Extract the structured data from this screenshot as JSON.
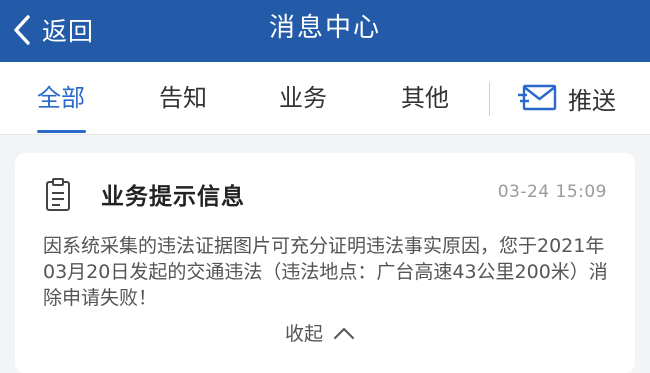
{
  "header": {
    "back_label": "返回",
    "title": "消息中心",
    "background": "#245ba8"
  },
  "tabs": [
    {
      "label": "全部",
      "active": true
    },
    {
      "label": "告知",
      "active": false
    },
    {
      "label": "业务",
      "active": false
    },
    {
      "label": "其他",
      "active": false
    }
  ],
  "push": {
    "label": "推送",
    "icon": "mail-send-icon"
  },
  "accent_color": "#2a69c9",
  "message": {
    "icon": "clipboard-icon",
    "title": "业务提示信息",
    "time": "03-24 15:09",
    "body": "因系统采集的违法证据图片可充分证明违法事实原因，您于2021年03月20日发起的交通违法（违法地点：广台高速43公里200米）消除申请失败！",
    "collapse_label": "收起",
    "collapse_icon": "chevron-up-icon"
  }
}
